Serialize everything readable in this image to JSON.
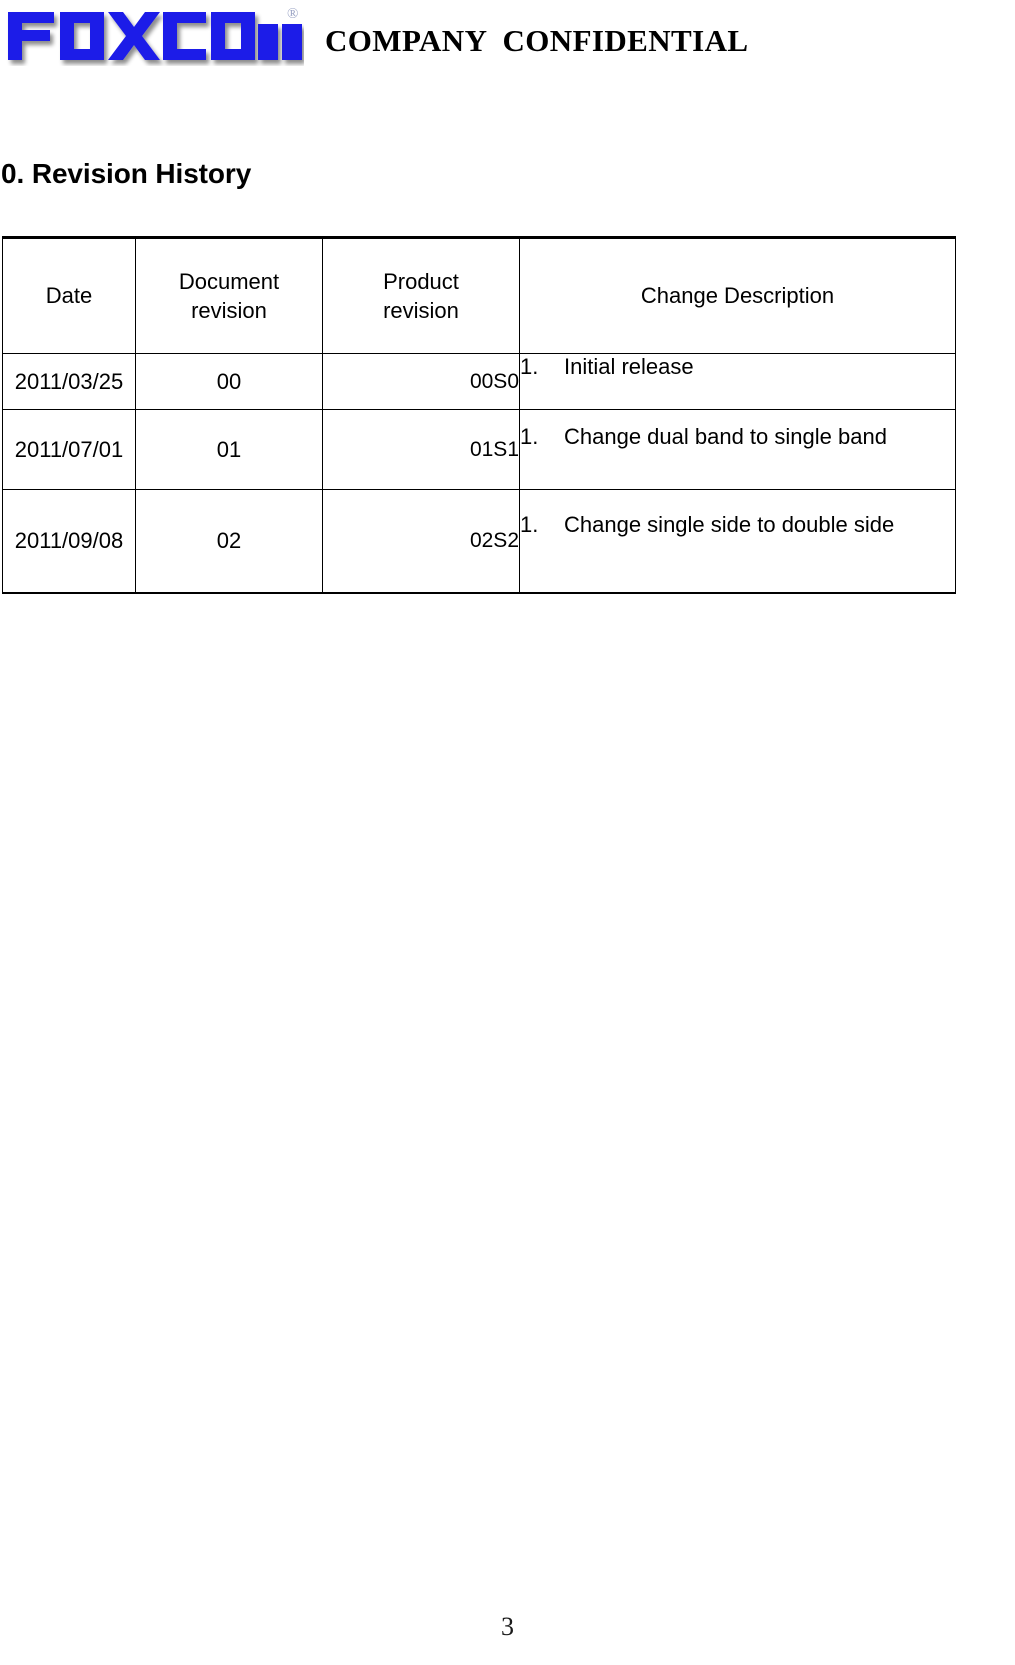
{
  "header": {
    "logo_alt": "FOXCONN",
    "logo_wordmark": "FOXCONN",
    "logo_trademark": "®",
    "logo_color": "#1a1ae8",
    "confidential_title": "COMPANY  CONFIDENTIAL"
  },
  "section": {
    "heading": "0. Revision History"
  },
  "table": {
    "columns": [
      {
        "label_line1": "Date",
        "label_line2": ""
      },
      {
        "label_line1": "Document",
        "label_line2": "revision"
      },
      {
        "label_line1": "Product",
        "label_line2": "revision"
      },
      {
        "label_line1": "Change Description",
        "label_line2": ""
      }
    ],
    "rows": [
      {
        "date": "2011/03/25",
        "document_revision": "00",
        "product_revision": "00S0",
        "change_number": "1.",
        "change_description": "Initial release"
      },
      {
        "date": "2011/07/01",
        "document_revision": "01",
        "product_revision": "01S1",
        "change_number": "1.",
        "change_description": "Change dual band to single band"
      },
      {
        "date": "2011/09/08",
        "document_revision": "02",
        "product_revision": "02S2",
        "change_number": "1.",
        "change_description": "Change single side to double side"
      }
    ]
  },
  "footer": {
    "page_number": "3"
  }
}
